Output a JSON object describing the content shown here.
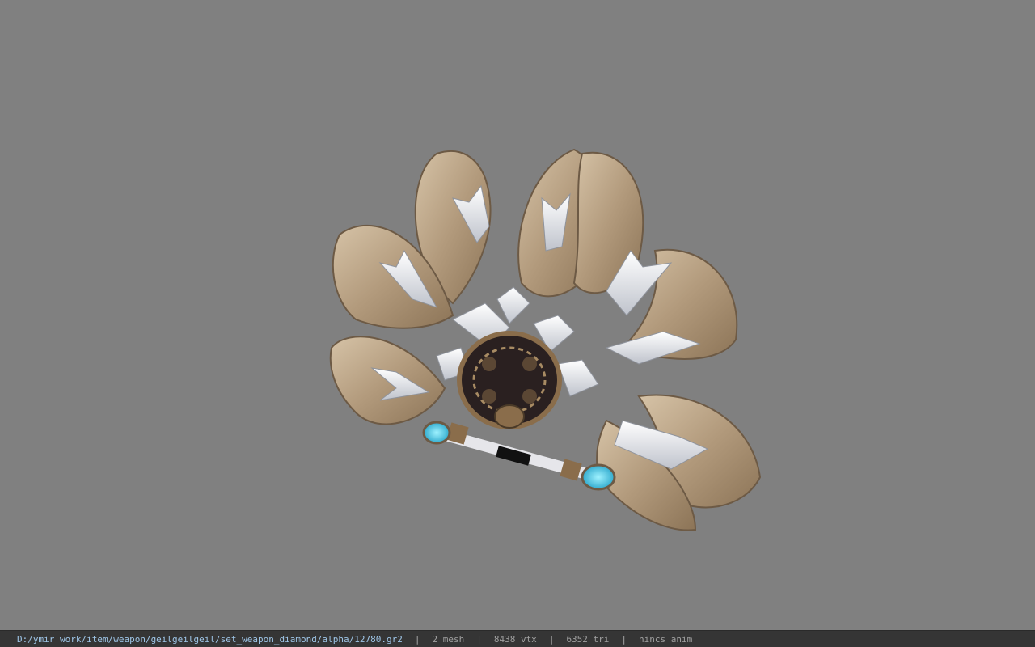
{
  "viewport": {
    "background": "#808080",
    "model_icon": "fan-weapon-model"
  },
  "status": {
    "path": "D:/ymir work/item/weapon/geilgeilgeil/set_weapon_diamond/alpha/12780.gr2",
    "separator": "|",
    "mesh": "2 mesh",
    "vtx": "8438 vtx",
    "tri": "6352 tri",
    "anim": "nincs anim"
  },
  "colors": {
    "path_text": "#9fc6e8",
    "stat_text": "#a0a0a0",
    "status_bg": "#353535",
    "feather": "#b9a286",
    "blade": "#e8e8ee",
    "gem": "#39c4e6"
  }
}
